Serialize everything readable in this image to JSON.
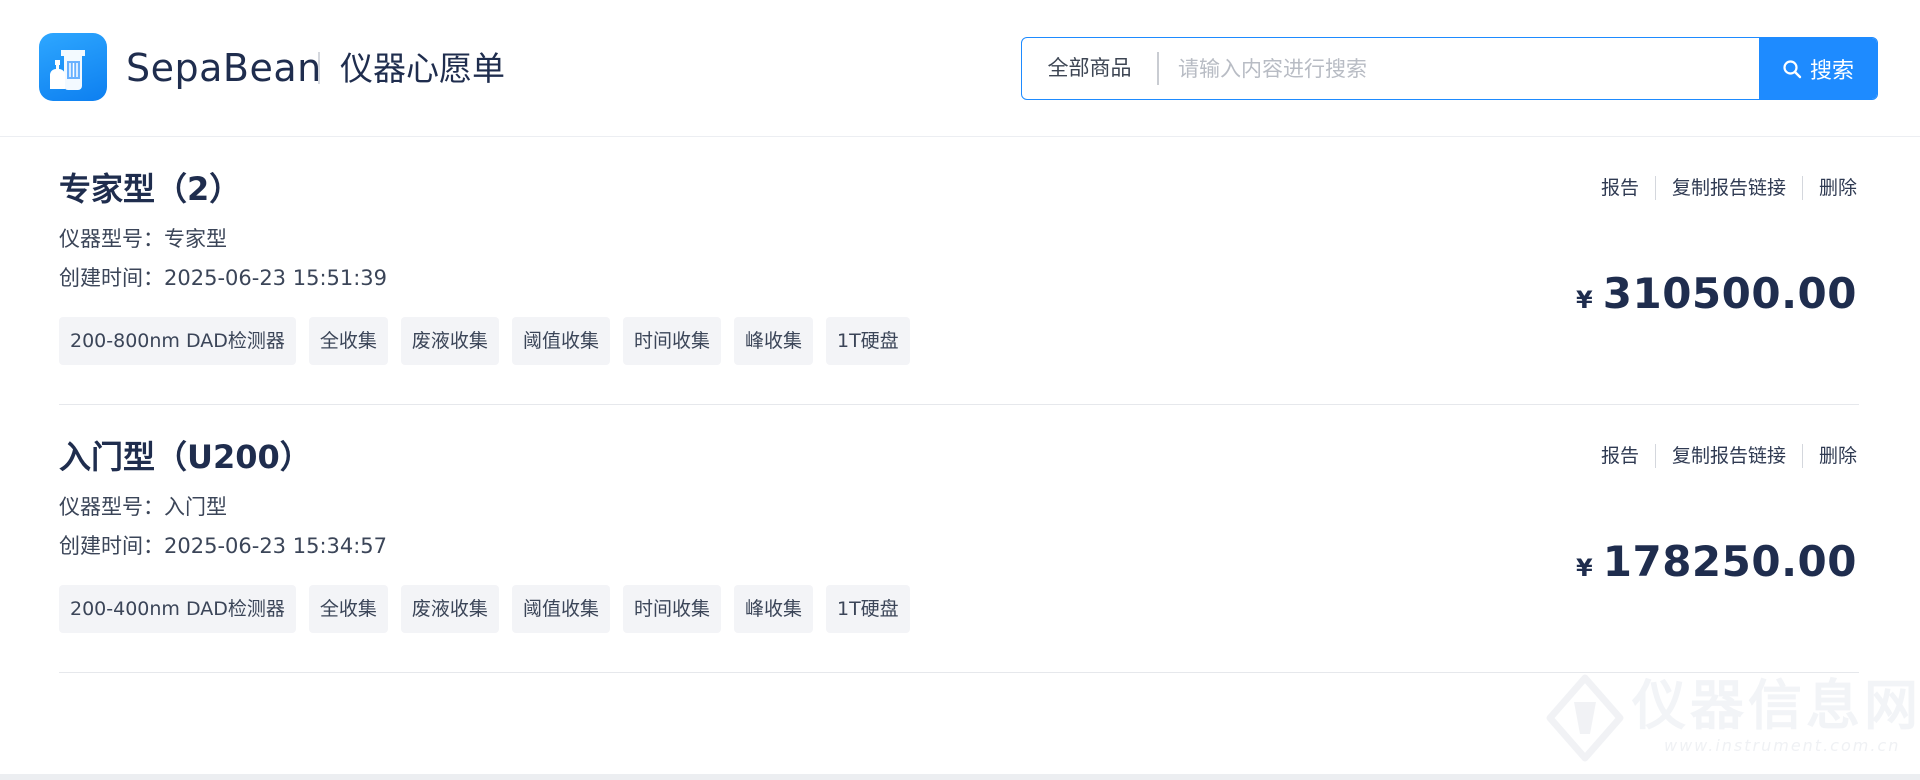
{
  "header": {
    "brand": "SepaBean",
    "subtitle": "仪器心愿单",
    "search": {
      "scope_label": "全部商品",
      "placeholder": "请输入内容进行搜索",
      "value": "",
      "button_label": "搜索"
    }
  },
  "wishlist": {
    "model_label": "仪器型号：",
    "created_label": "创建时间：",
    "action_labels": [
      "报告",
      "复制报告链接",
      "删除"
    ],
    "currency_symbol": "¥",
    "items": [
      {
        "title": "专家型（2）",
        "model": "专家型",
        "created": "2025-06-23 15:51:39",
        "tags": [
          "200-800nm DAD检测器",
          "全收集",
          "废液收集",
          "阈值收集",
          "时间收集",
          "峰收集",
          "1T硬盘"
        ],
        "price": "310500.00"
      },
      {
        "title": "入门型（U200）",
        "model": "入门型",
        "created": "2025-06-23 15:34:57",
        "tags": [
          "200-400nm DAD检测器",
          "全收集",
          "废液收集",
          "阈值收集",
          "时间收集",
          "峰收集",
          "1T硬盘"
        ],
        "price": "178250.00"
      }
    ]
  },
  "watermark": {
    "text": "仪器信息网",
    "url": "www.instrument.com.cn"
  },
  "colors": {
    "accent": "#1e8bff",
    "text_primary": "#1f2d4e",
    "tag_background": "#f3f4f7"
  },
  "icons": {
    "logo": "sepabean-logo-icon",
    "search": "magnifier-icon"
  }
}
